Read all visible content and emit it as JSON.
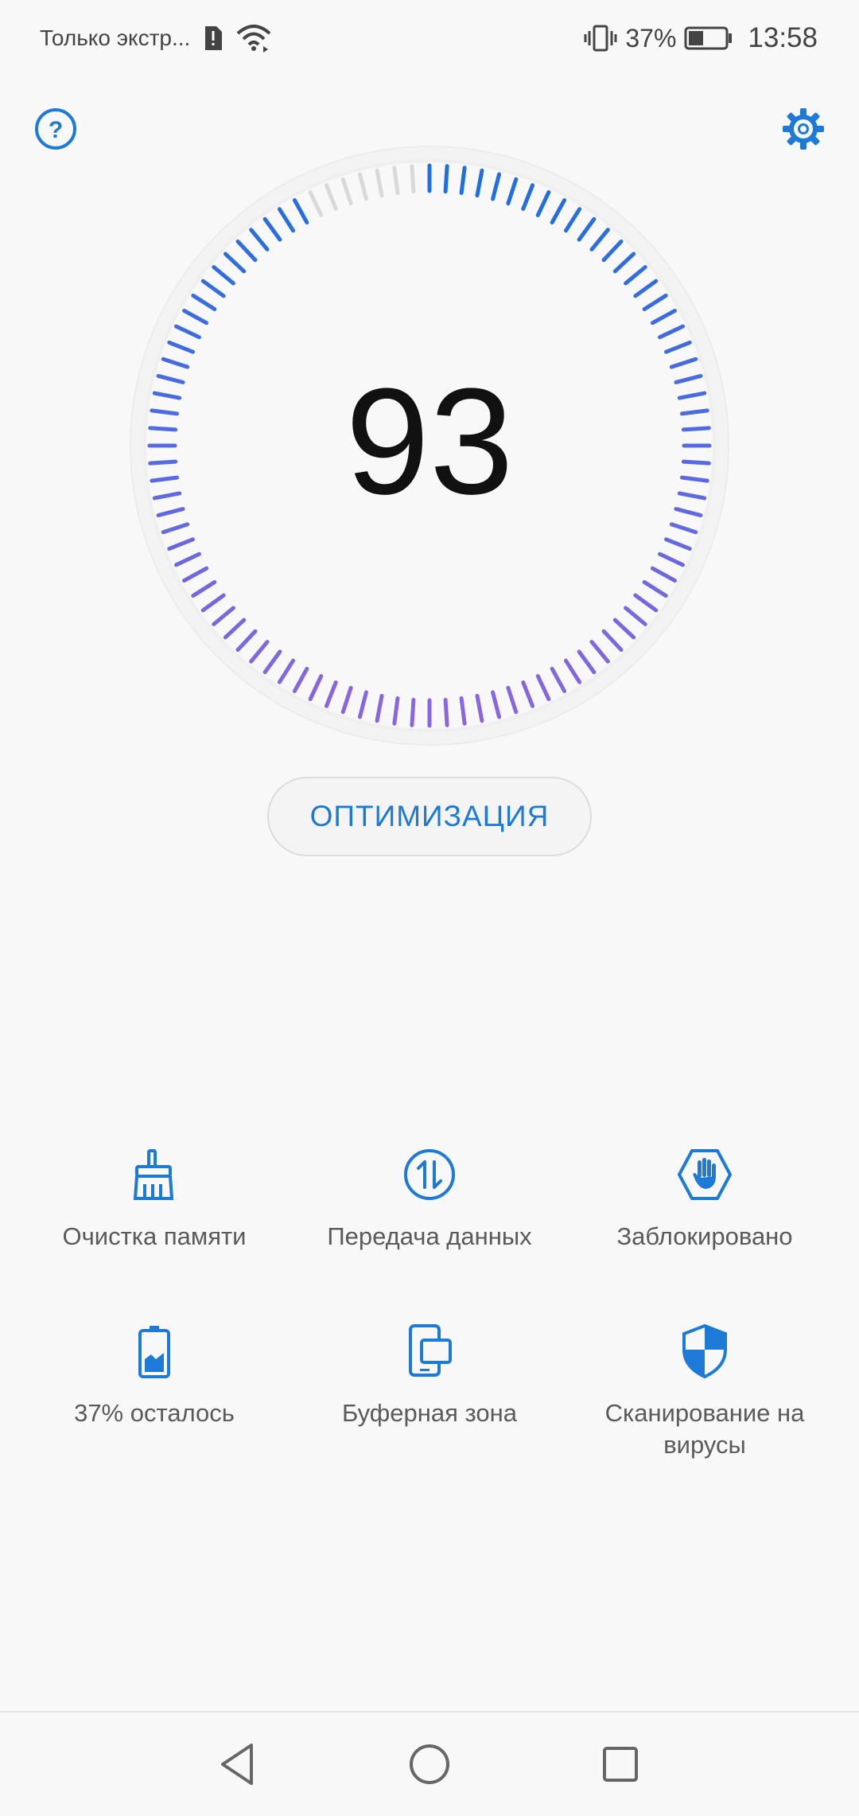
{
  "status_bar": {
    "carrier": "Только экстр...",
    "battery_percent": "37%",
    "time": "13:58"
  },
  "icons": {
    "help": "help-circle-icon",
    "settings": "gear-icon"
  },
  "gauge": {
    "score": "93",
    "score_value": 93,
    "max": 100,
    "colors": {
      "active_start": "#1f6fe0",
      "active_end": "#8a66e0",
      "inactive": "#d9d9d9"
    }
  },
  "optimize_button": {
    "label": "ОПТИМИЗАЦИЯ"
  },
  "tools": [
    {
      "label": "Очистка памяти",
      "icon": "broom-icon"
    },
    {
      "label": "Передача данных",
      "icon": "data-transfer-icon"
    },
    {
      "label": "Заблокировано",
      "icon": "block-hand-icon"
    },
    {
      "label": "37% осталось",
      "icon": "battery-icon"
    },
    {
      "label": "Буферная зона",
      "icon": "dual-screen-icon"
    },
    {
      "label": "Сканирование на вирусы",
      "icon": "shield-icon"
    }
  ],
  "colors": {
    "accent": "#1d7ad6",
    "text_secondary": "#5a5a5a"
  }
}
